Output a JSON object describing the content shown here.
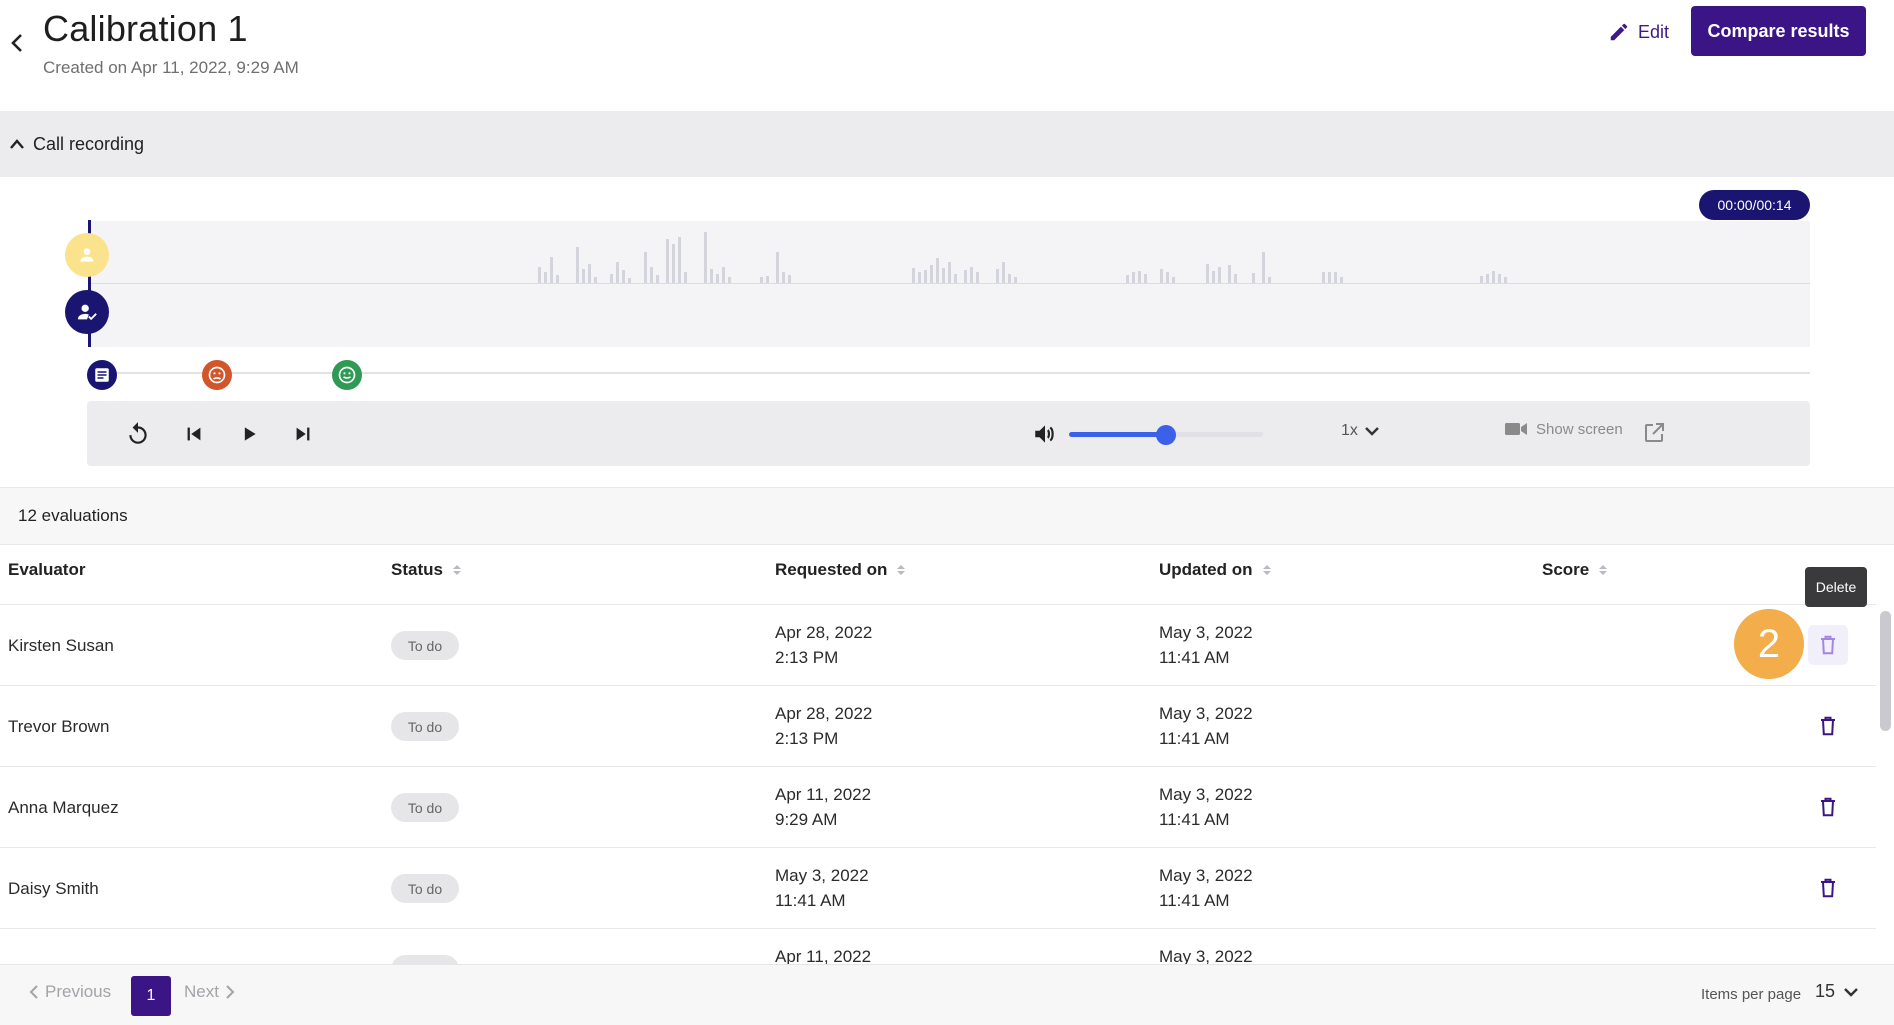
{
  "header": {
    "title": "Calibration 1",
    "subtitle": "Created on Apr 11, 2022, 9:29 AM",
    "edit_label": "Edit",
    "compare_label": "Compare results"
  },
  "recording": {
    "section_label": "Call recording",
    "time": "00:00/00:14",
    "speed": "1x",
    "volume_fraction": 0.5,
    "show_screen_label": "Show screen"
  },
  "evaluations": {
    "count_label": "12 evaluations",
    "columns": [
      "Evaluator",
      "Status",
      "Requested on",
      "Updated on",
      "Score"
    ],
    "rows": [
      {
        "evaluator": "Kirsten Susan",
        "status": "To do",
        "req_date": "Apr 28, 2022",
        "req_time": "2:13 PM",
        "upd_date": "May 3, 2022",
        "upd_time": "11:41 AM"
      },
      {
        "evaluator": "Trevor Brown",
        "status": "To do",
        "req_date": "Apr 28, 2022",
        "req_time": "2:13 PM",
        "upd_date": "May 3, 2022",
        "upd_time": "11:41 AM"
      },
      {
        "evaluator": "Anna Marquez",
        "status": "To do",
        "req_date": "Apr 11, 2022",
        "req_time": "9:29 AM",
        "upd_date": "May 3, 2022",
        "upd_time": "11:41 AM"
      },
      {
        "evaluator": "Daisy Smith",
        "status": "To do",
        "req_date": "May 3, 2022",
        "req_time": "11:41 AM",
        "upd_date": "May 3, 2022",
        "upd_time": "11:41 AM"
      },
      {
        "evaluator": "",
        "status": "",
        "req_date": "Apr 11, 2022",
        "req_time": "",
        "upd_date": "May 3, 2022",
        "upd_time": ""
      }
    ],
    "tooltip": "Delete",
    "step_marker": "2"
  },
  "pager": {
    "previous_label": "Previous",
    "current_page": "1",
    "next_label": "Next",
    "items_per_page_label": "Items per page",
    "items_per_page_value": "15"
  },
  "colors": {
    "brand": "#3b1586",
    "navy": "#1a1571",
    "accent_blue": "#3d60e8",
    "step_orange": "#f3ad4b",
    "negative": "#d2562b",
    "positive": "#2f9a54"
  }
}
